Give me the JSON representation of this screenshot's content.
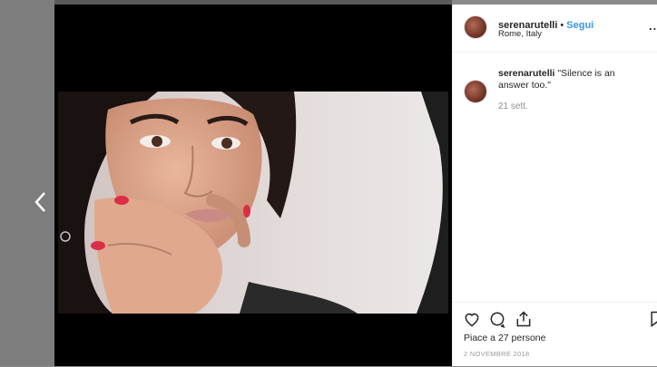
{
  "post": {
    "username": "serenarutelli",
    "follow_label": "Segui",
    "location": "Rome, Italy",
    "more_label": "...",
    "caption_username": "serenarutelli",
    "caption_text": "\"Silence is an answer too.\"",
    "time_ago": "21 sett.",
    "likes": "Piace a 27 persone",
    "date": "2 NOVEMBRE 2018"
  },
  "icons": {
    "prev": "chevron-left-icon",
    "like": "heart-icon",
    "comment": "comment-icon",
    "share": "share-icon",
    "save": "bookmark-icon"
  },
  "colors": {
    "link": "#3897f0",
    "text": "#262626",
    "muted": "#8e8e8e"
  }
}
